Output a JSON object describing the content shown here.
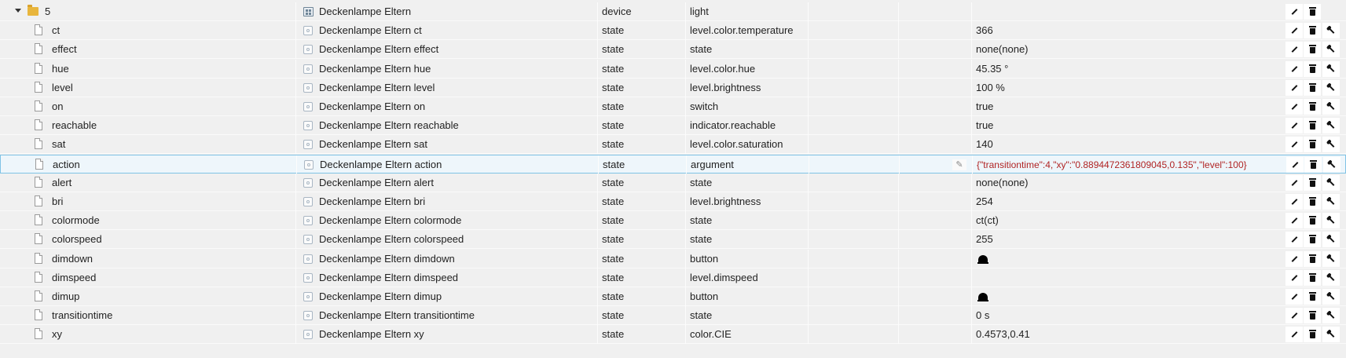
{
  "rows": [
    {
      "id": "5",
      "name": "Deckenlampe Eltern",
      "type": "device",
      "role": "light",
      "value": "",
      "kind": "folder"
    },
    {
      "id": "ct",
      "name": "Deckenlampe Eltern ct",
      "type": "state",
      "role": "level.color.temperature",
      "value": "366"
    },
    {
      "id": "effect",
      "name": "Deckenlampe Eltern effect",
      "type": "state",
      "role": "state",
      "value": "none(none)"
    },
    {
      "id": "hue",
      "name": "Deckenlampe Eltern hue",
      "type": "state",
      "role": "level.color.hue",
      "value": "45.35 °"
    },
    {
      "id": "level",
      "name": "Deckenlampe Eltern level",
      "type": "state",
      "role": "level.brightness",
      "value": "100 %"
    },
    {
      "id": "on",
      "name": "Deckenlampe Eltern on",
      "type": "state",
      "role": "switch",
      "value": "true"
    },
    {
      "id": "reachable",
      "name": "Deckenlampe Eltern reachable",
      "type": "state",
      "role": "indicator.reachable",
      "value": "true"
    },
    {
      "id": "sat",
      "name": "Deckenlampe Eltern sat",
      "type": "state",
      "role": "level.color.saturation",
      "value": "140"
    },
    {
      "id": "action",
      "name": "Deckenlampe Eltern action",
      "type": "state",
      "role": "argument",
      "value": "{\"transitiontime\":4,\"xy\":\"0.8894472361809045,0.135\",\"level\":100}",
      "selected": true,
      "json": true
    },
    {
      "id": "alert",
      "name": "Deckenlampe Eltern alert",
      "type": "state",
      "role": "state",
      "value": "none(none)"
    },
    {
      "id": "bri",
      "name": "Deckenlampe Eltern bri",
      "type": "state",
      "role": "level.brightness",
      "value": "254"
    },
    {
      "id": "colormode",
      "name": "Deckenlampe Eltern colormode",
      "type": "state",
      "role": "state",
      "value": "ct(ct)"
    },
    {
      "id": "colorspeed",
      "name": "Deckenlampe Eltern colorspeed",
      "type": "state",
      "role": "state",
      "value": "255"
    },
    {
      "id": "dimdown",
      "name": "Deckenlampe Eltern dimdown",
      "type": "state",
      "role": "button",
      "value": "",
      "icon": "bell-icon"
    },
    {
      "id": "dimspeed",
      "name": "Deckenlampe Eltern dimspeed",
      "type": "state",
      "role": "level.dimspeed",
      "value": ""
    },
    {
      "id": "dimup",
      "name": "Deckenlampe Eltern dimup",
      "type": "state",
      "role": "button",
      "value": "",
      "icon": "bell-icon"
    },
    {
      "id": "transitiontime",
      "name": "Deckenlampe Eltern transitiontime",
      "type": "state",
      "role": "state",
      "value": "0 s"
    },
    {
      "id": "xy",
      "name": "Deckenlampe Eltern xy",
      "type": "state",
      "role": "color.CIE",
      "value": "0.4573,0.41"
    }
  ],
  "icons": {
    "folder": "folder-icon",
    "file": "file-icon",
    "device": "device-icon",
    "state": "state-icon",
    "actions": [
      "pencil-icon",
      "trash-icon",
      "wrench-icon"
    ]
  },
  "colors": {
    "row_bg": "#f0f0f0",
    "selected_border": "#7fc3e5",
    "json_value": "#b02424",
    "folder": "#e8b53c"
  }
}
